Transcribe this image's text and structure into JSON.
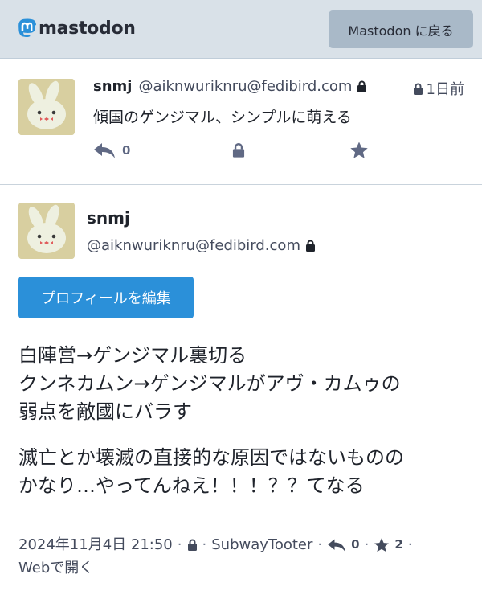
{
  "header": {
    "logo_text": "mastodon",
    "back_button": "Mastodon に戻る"
  },
  "status": {
    "display_name": "snmj",
    "acct": "@aiknwuriknru@fedibird.com",
    "time": "1日前",
    "content": "傾国のゲンジマル、シンプルに萌える",
    "reply_count": "0"
  },
  "profile": {
    "display_name": "snmj",
    "acct": "@aiknwuriknru@fedibird.com",
    "edit_button": "プロフィールを編集",
    "bio_lines": [
      "白陣営→ゲンジマル裏切る",
      "クンネカムン→ゲンジマルがアヴ・カムゥの",
      "弱点を敵國にバラす",
      "滅亡とか壊滅の直接的な原因ではないものの",
      "かなり…やってんねえ！！！？？てなる"
    ]
  },
  "meta": {
    "date": "2024年11月4日 21:50",
    "app": "SubwayTooter",
    "replies": "0",
    "favourites": "2",
    "open_web": "Webで開く"
  },
  "colors": {
    "header_bg": "#d9e1e8",
    "accent": "#2b90d9",
    "icon": "#606984"
  }
}
